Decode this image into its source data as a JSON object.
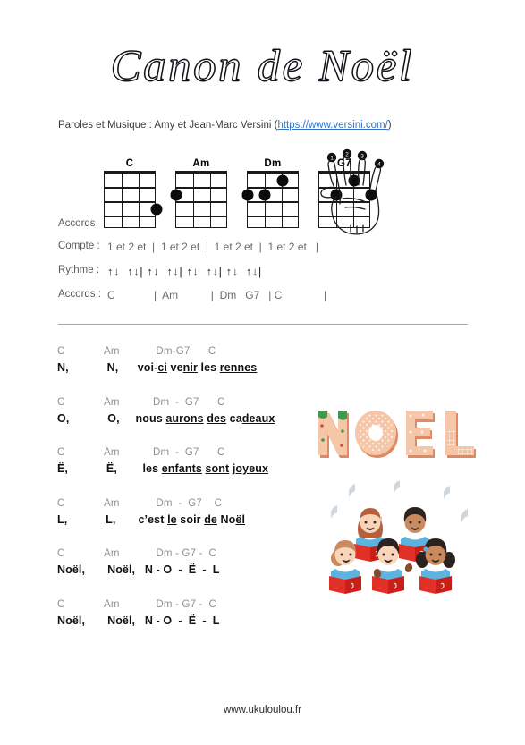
{
  "document": {
    "title": "Canon de Noël",
    "credits_prefix": "Paroles et Musique : Amy et Jean-Marc Versini (",
    "credits_link": "https://www.versini.com/",
    "credits_suffix": ")",
    "footer": "www.ukuloulou.fr"
  },
  "chord_diagrams": {
    "strings": 4,
    "frets": 4,
    "items": [
      {
        "name": "C",
        "dots": [
          {
            "string": 4,
            "fret": 3
          }
        ]
      },
      {
        "name": "Am",
        "dots": [
          {
            "string": 1,
            "fret": 2
          }
        ]
      },
      {
        "name": "Dm",
        "dots": [
          {
            "string": 3,
            "fret": 1
          },
          {
            "string": 1,
            "fret": 2
          },
          {
            "string": 2,
            "fret": 2
          }
        ]
      },
      {
        "name": "G7",
        "dots": [
          {
            "string": 3,
            "fret": 1
          },
          {
            "string": 2,
            "fret": 2
          },
          {
            "string": 4,
            "fret": 2
          }
        ]
      }
    ]
  },
  "hand": {
    "finger_numbers": [
      "1",
      "2",
      "3",
      "4"
    ]
  },
  "rhythm_table": {
    "accords_label": "Accords",
    "compte_label": "Compte :",
    "compte_value": "1 et 2 et  |  1 et 2 et  |  1 et 2 et  |  1 et 2 et   |",
    "rythme_label": "Rythme :",
    "rythme_value": "↑↓  ↑↓| ↑↓  ↑↓| ↑↓  ↑↓| ↑↓  ↑↓|",
    "accords2_label": "Accords :",
    "accords2_value": "C             |  Am           |  Dm   G7   | C              |"
  },
  "verses": [
    {
      "chords": "C             Am            Dm-G7      C",
      "lyrics_html": "N,            N,      voi-<u>ci</u> ve<u>nir</u> les <u>rennes</u>"
    },
    {
      "chords": "C             Am           Dm  -  G7      C",
      "lyrics_html": "O,            O,     nous <u>aurons</u> <u>des</u> ca<u>deaux</u>"
    },
    {
      "chords": "C             Am           Dm  -  G7      C",
      "lyrics_html": "Ë,            Ë,        les <u>enfants</u> <u>sont</u> <u>joyeux</u>"
    },
    {
      "chords": "C             Am            Dm  -  G7    C",
      "lyrics_html": "L,            L,       c’est <u>le</u> soir <u>de</u> No<u>ël</u>"
    },
    {
      "chords": "C             Am            Dm - G7 -  C",
      "lyrics_html": "Noël,       Noël,   N - O  -  Ë  -  L"
    },
    {
      "chords": "C             Am            Dm - G7 -  C",
      "lyrics_html": "Noël,       Noël,   N - O  -  Ë  -  L"
    }
  ],
  "noel_art": {
    "letters": [
      "N",
      "O",
      "E",
      "L"
    ],
    "style": "gingerbread",
    "colors": {
      "body": "#f6c6a8",
      "shade": "#e08a63",
      "icing": "#f8f2e8",
      "holly": "#3d9a4e",
      "berry": "#d64a3c"
    }
  },
  "choir": {
    "children_count": 5,
    "book_color": "#e03027",
    "shirt_color": "#5bb4e0"
  }
}
